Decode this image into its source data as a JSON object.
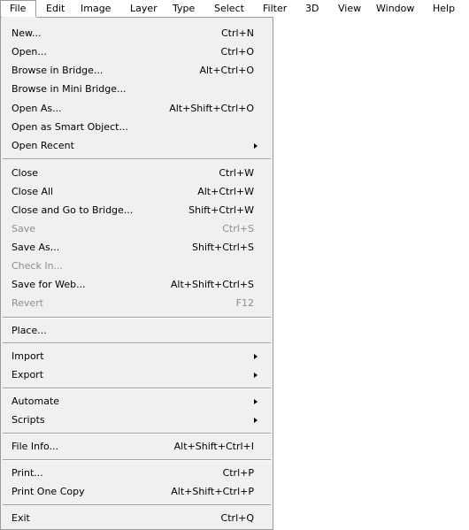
{
  "menubar": {
    "items": [
      "File",
      "Edit",
      "Image",
      "Layer",
      "Type",
      "Select",
      "Filter",
      "3D",
      "View",
      "Window",
      "Help"
    ]
  },
  "file_menu": {
    "new": {
      "label": "New...",
      "shortcut": "Ctrl+N"
    },
    "open": {
      "label": "Open...",
      "shortcut": "Ctrl+O"
    },
    "browse_bridge": {
      "label": "Browse in Bridge...",
      "shortcut": "Alt+Ctrl+O"
    },
    "browse_mini_bridge": {
      "label": "Browse in Mini Bridge...",
      "shortcut": ""
    },
    "open_as": {
      "label": "Open As...",
      "shortcut": "Alt+Shift+Ctrl+O"
    },
    "open_smart_object": {
      "label": "Open as Smart Object...",
      "shortcut": ""
    },
    "open_recent": {
      "label": "Open Recent"
    },
    "close": {
      "label": "Close",
      "shortcut": "Ctrl+W"
    },
    "close_all": {
      "label": "Close All",
      "shortcut": "Alt+Ctrl+W"
    },
    "close_go_bridge": {
      "label": "Close and Go to Bridge...",
      "shortcut": "Shift+Ctrl+W"
    },
    "save": {
      "label": "Save",
      "shortcut": "Ctrl+S"
    },
    "save_as": {
      "label": "Save As...",
      "shortcut": "Shift+Ctrl+S"
    },
    "check_in": {
      "label": "Check In...",
      "shortcut": ""
    },
    "save_for_web": {
      "label": "Save for Web...",
      "shortcut": "Alt+Shift+Ctrl+S"
    },
    "revert": {
      "label": "Revert",
      "shortcut": "F12"
    },
    "place": {
      "label": "Place...",
      "shortcut": ""
    },
    "import": {
      "label": "Import"
    },
    "export": {
      "label": "Export"
    },
    "automate": {
      "label": "Automate"
    },
    "scripts": {
      "label": "Scripts"
    },
    "file_info": {
      "label": "File Info...",
      "shortcut": "Alt+Shift+Ctrl+I"
    },
    "print": {
      "label": "Print...",
      "shortcut": "Ctrl+P"
    },
    "print_one_copy": {
      "label": "Print One Copy",
      "shortcut": "Alt+Shift+Ctrl+P"
    },
    "exit": {
      "label": "Exit",
      "shortcut": "Ctrl+Q"
    }
  },
  "colors": {
    "menu_background": "#f0f0f0",
    "border": "#9a9a9a",
    "disabled_text": "#8d8d8d"
  }
}
